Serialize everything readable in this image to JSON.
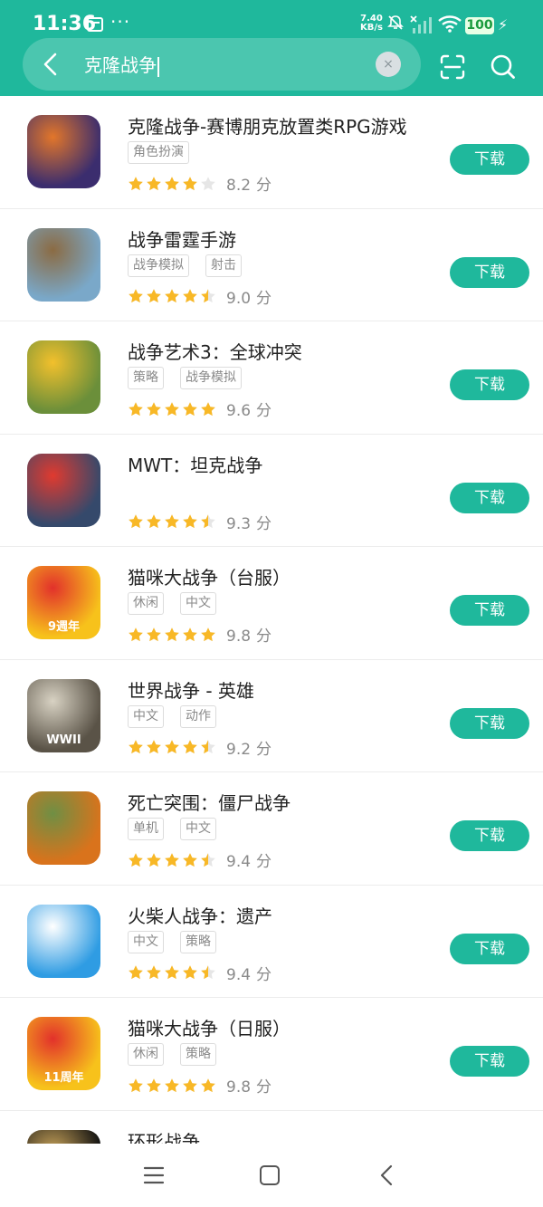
{
  "status_bar": {
    "time": "11:36",
    "net_speed_value": "7.40",
    "net_speed_unit": "KB/s",
    "more_dots": "···",
    "battery": "100"
  },
  "search": {
    "query": "克隆战争",
    "clear_symbol": "×"
  },
  "download_label": "下载",
  "score_unit": "分",
  "apps": [
    {
      "name": "克隆战争-赛博朋克放置类RPG游戏",
      "tags": [
        "角色扮演"
      ],
      "stars": 4,
      "score": "8.2",
      "icon": "pumpkin-robot",
      "colors": [
        "#3b2d6e",
        "#e2762a"
      ]
    },
    {
      "name": "战争雷霆手游",
      "tags": [
        "战争模拟",
        "射击"
      ],
      "stars": 4.5,
      "score": "9.0",
      "icon": "tank",
      "colors": [
        "#7aa8c9",
        "#8b6b43"
      ]
    },
    {
      "name": "战争艺术3：全球冲突",
      "tags": [
        "策略",
        "战争模拟"
      ],
      "stars": 5,
      "score": "9.6",
      "icon": "battlefield",
      "colors": [
        "#6b8f3a",
        "#f2c02c"
      ]
    },
    {
      "name": "MWT：坦克战争",
      "tags": [],
      "stars": 4.5,
      "score": "9.3",
      "icon": "tank-6v6",
      "colors": [
        "#35496b",
        "#e03a2f"
      ]
    },
    {
      "name": "猫咪大战争（台服）",
      "tags": [
        "休闲",
        "中文"
      ],
      "stars": 5,
      "score": "9.8",
      "icon": "cat-9",
      "colors": [
        "#f7c21b",
        "#e2312b"
      ],
      "badge": "9週年"
    },
    {
      "name": "世界战争 - 英雄",
      "tags": [
        "中文",
        "动作"
      ],
      "stars": 4.5,
      "score": "9.2",
      "icon": "soldier-wwii",
      "colors": [
        "#5a5347",
        "#d8d2c3"
      ],
      "badge": "WWII"
    },
    {
      "name": "死亡突围：僵尸战争",
      "tags": [
        "单机",
        "中文"
      ],
      "stars": 4.5,
      "score": "9.4",
      "icon": "zombie",
      "colors": [
        "#d9731c",
        "#6f8f44"
      ]
    },
    {
      "name": "火柴人战争：遗产",
      "tags": [
        "中文",
        "策略"
      ],
      "stars": 4.5,
      "score": "9.4",
      "icon": "stickman",
      "colors": [
        "#2f9ce3",
        "#ffffff"
      ]
    },
    {
      "name": "猫咪大战争（日服）",
      "tags": [
        "休闲",
        "策略"
      ],
      "stars": 5,
      "score": "9.8",
      "icon": "cat-11",
      "colors": [
        "#f7c21b",
        "#e2312b"
      ],
      "badge": "11周年"
    },
    {
      "name": "环形战争",
      "tags": [],
      "stars": 0,
      "score": "",
      "icon": "ring",
      "colors": [
        "#111111",
        "#c9a45a"
      ]
    }
  ],
  "colors": {
    "accent": "#1fb89c",
    "star": "#f8b826",
    "star_empty": "#e6e6e6"
  }
}
